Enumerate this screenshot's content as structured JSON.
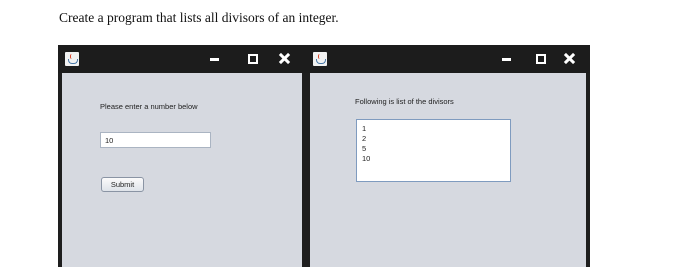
{
  "prompt": "Create a program that lists all divisors of an integer.",
  "left_window": {
    "icon": "java-icon",
    "label": "Please enter a number below",
    "input_value": "10",
    "button_label": "Submit"
  },
  "right_window": {
    "icon": "java-icon",
    "label": "Following is list of the divisors",
    "divisors": [
      "1",
      "2",
      "5",
      "10"
    ]
  }
}
